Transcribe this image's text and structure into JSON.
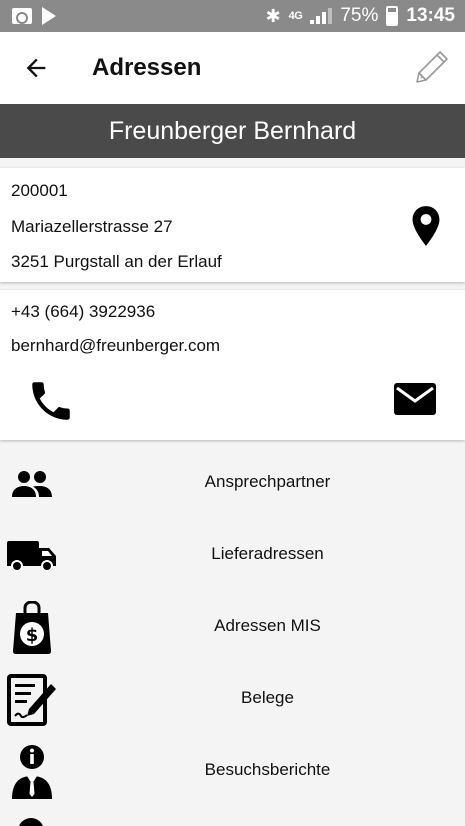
{
  "status_bar": {
    "network": "4G",
    "battery": "75%",
    "time": "13:45"
  },
  "app_bar": {
    "title": "Adressen"
  },
  "customer": {
    "name": "Freunberger Bernhard"
  },
  "address": {
    "number": "200001",
    "street": "Mariazellerstrasse 27",
    "city": "3251 Purgstall an der Erlauf"
  },
  "contact": {
    "phone": "+43 (664) 3922936",
    "email": "bernhard@freunberger.com"
  },
  "menu": [
    {
      "label": "Ansprechpartner",
      "icon": "people-icon"
    },
    {
      "label": "Lieferadressen",
      "icon": "truck-icon"
    },
    {
      "label": "Adressen MIS",
      "icon": "money-bag-icon"
    },
    {
      "label": "Belege",
      "icon": "document-edit-icon"
    },
    {
      "label": "Besuchsberichte",
      "icon": "person-info-icon"
    }
  ]
}
